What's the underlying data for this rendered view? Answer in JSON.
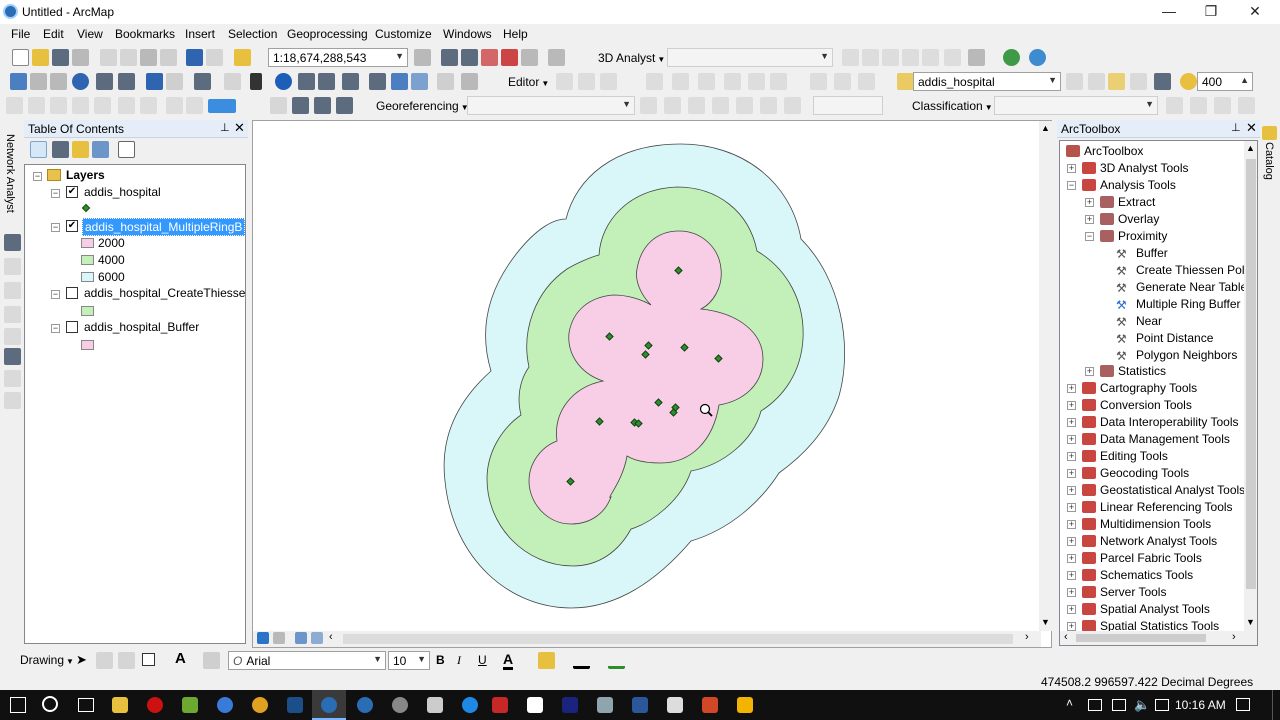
{
  "window": {
    "title": "Untitled - ArcMap",
    "minimize": "—",
    "maximize": "❐",
    "close": "✕"
  },
  "menu": [
    "File",
    "Edit",
    "View",
    "Bookmarks",
    "Insert",
    "Selection",
    "Geoprocessing",
    "Customize",
    "Windows",
    "Help"
  ],
  "toolbar": {
    "scale": "1:18,674,288,543",
    "analyst_3d": "3D Analyst",
    "editor": "Editor",
    "layer_combo": "addis_hospital",
    "zoom_value": "400",
    "georeferencing": "Georeferencing",
    "classification": "Classification"
  },
  "left_strip": {
    "network_analyst": "Network Analyst"
  },
  "toc": {
    "title": "Table Of Contents",
    "root": "Layers",
    "layers": [
      {
        "name": "addis_hospital",
        "checked": true
      },
      {
        "name": "addis_hospital_MultipleRingB",
        "checked": true,
        "selected": true
      },
      {
        "name": "addis_hospital_CreateThiesse",
        "checked": false
      },
      {
        "name": "addis_hospital_Buffer",
        "checked": false
      }
    ],
    "legend": [
      {
        "label": "2000",
        "color": "#f8cde6"
      },
      {
        "label": "4000",
        "color": "#c3f0b8"
      },
      {
        "label": "6000",
        "color": "#d9f7f8"
      }
    ]
  },
  "arctoolbox": {
    "title": "ArcToolbox",
    "root": "ArcToolbox",
    "items": [
      "3D Analyst Tools",
      "Analysis Tools",
      "Extract",
      "Overlay",
      "Proximity",
      "Buffer",
      "Create Thiessen Polyg",
      "Generate Near Table",
      "Multiple Ring Buffer",
      "Near",
      "Point Distance",
      "Polygon Neighbors",
      "Statistics",
      "Cartography Tools",
      "Conversion Tools",
      "Data Interoperability Tools",
      "Data Management Tools",
      "Editing Tools",
      "Geocoding Tools",
      "Geostatistical Analyst Tools",
      "Linear Referencing Tools",
      "Multidimension Tools",
      "Network Analyst Tools",
      "Parcel Fabric Tools",
      "Schematics Tools",
      "Server Tools",
      "Spatial Analyst Tools",
      "Spatial Statistics Tools"
    ]
  },
  "catalog_tab": "Catalog",
  "drawing": {
    "label": "Drawing",
    "font": "Arial",
    "size": "10",
    "bold": "B",
    "italic": "I",
    "underline": "U",
    "font_color": "A"
  },
  "status": {
    "coords": "474508.2  996597.422 Decimal Degrees"
  },
  "taskbar": {
    "time": "10:16 AM"
  },
  "colors": {
    "ring_2000": "#f8cde6",
    "ring_4000": "#c3f0b8",
    "ring_6000": "#d9f7f8",
    "selection": "#3399ff"
  }
}
